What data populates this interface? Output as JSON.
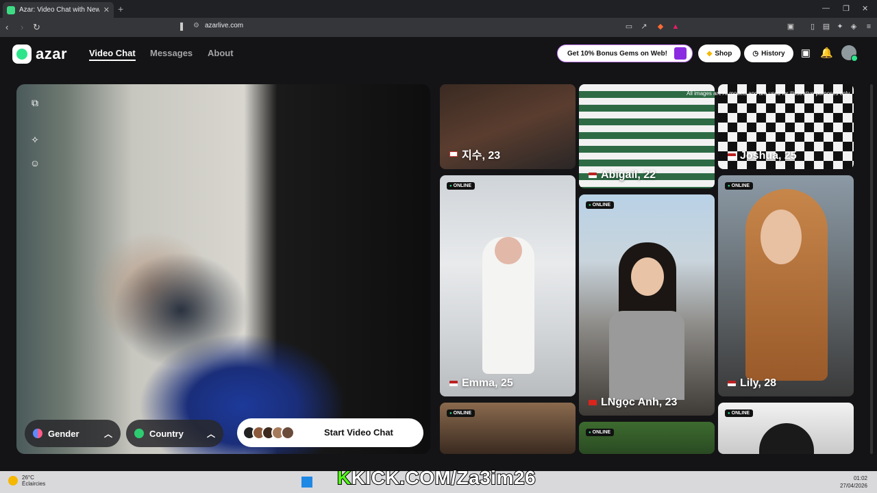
{
  "browser": {
    "tab_title": "Azar: Video Chat with New Pe",
    "url": "azarlive.com"
  },
  "header": {
    "brand": "azar",
    "nav": [
      "Video Chat",
      "Messages",
      "About"
    ],
    "promo": "Get 10% Bonus Gems on Web!",
    "shop": "Shop",
    "history": "History"
  },
  "video": {
    "gender_label": "Gender",
    "country_label": "Country",
    "start_label": "Start Video Chat"
  },
  "disclaimer": "All images are AI models and are used for illustrative purposes only.",
  "online_badge": "ONLINE",
  "profiles": [
    {
      "name": "지수, 23",
      "flag": "kr"
    },
    {
      "name": "Emma, 25",
      "flag": "us",
      "online": true
    },
    {
      "name": "Abigail, 22",
      "flag": "us"
    },
    {
      "name": "LNgọc Anh, 23",
      "flag": "vn",
      "online": true
    },
    {
      "name": "Joshua, 25",
      "flag": "us"
    },
    {
      "name": "Lily, 28",
      "flag": "us",
      "online": true
    }
  ],
  "taskbar": {
    "temp": "26°C",
    "weather": "Éclaircies",
    "overlay_prefix": "K",
    "overlay_text": "KICK.COM/Za3im26",
    "time": "01:02",
    "date": "27/04/2026"
  }
}
